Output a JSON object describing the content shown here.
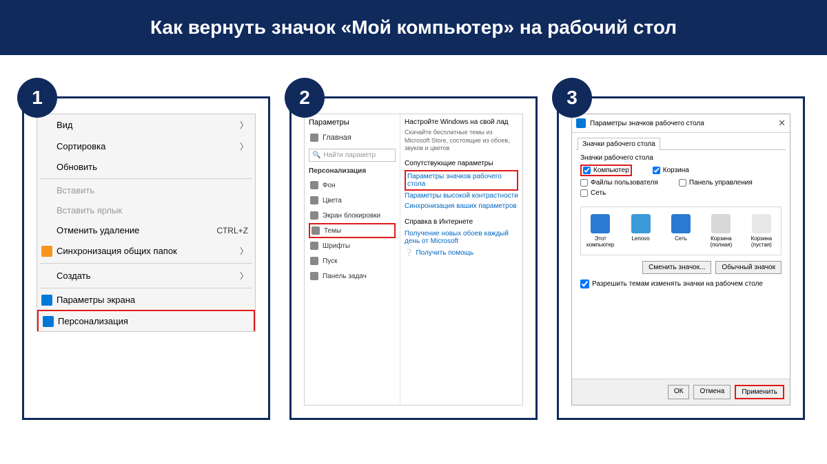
{
  "title": "Как вернуть значок «Мой компьютер» на рабочий стол",
  "steps": {
    "n1": "1",
    "n2": "2",
    "n3": "3"
  },
  "ctx": {
    "view": "Вид",
    "sort": "Сортировка",
    "refresh": "Обновить",
    "paste": "Вставить",
    "paste_shortcut": "Вставить ярлык",
    "undo_delete": "Отменить удаление",
    "undo_key": "CTRL+Z",
    "sync": "Синхронизация общих папок",
    "create": "Создать",
    "display": "Параметры экрана",
    "personalize": "Персонализация"
  },
  "settings": {
    "win": "Параметры",
    "home": "Главная",
    "search": "Найти параметр",
    "section": "Персонализация",
    "nav": {
      "background": "Фон",
      "colors": "Цвета",
      "lockscreen": "Экран блокировки",
      "themes": "Темы",
      "fonts": "Шрифты",
      "start": "Пуск",
      "taskbar": "Панель задач"
    },
    "right": {
      "h1": "Настройте Windows на свой лад",
      "p1": "Скачайте бесплатные темы из Microsoft Store, состоящие из обоев, звуков и цветов",
      "h2": "Сопутствующие параметры",
      "link1": "Параметры значков рабочего стола",
      "link2": "Параметры высокой контрастности",
      "link3": "Синхронизация ваших параметров",
      "h3": "Справка в Интернете",
      "link4": "Получение новых обоев каждый день от Microsoft",
      "help": "Получить помощь"
    }
  },
  "dlg": {
    "title": "Параметры значков рабочего стола",
    "tab": "Значки рабочего стола",
    "group": "Значки рабочего стола",
    "chk": {
      "computer": "Компьютер",
      "recycle": "Корзина",
      "userfiles": "Файлы пользователя",
      "control": "Панель управления",
      "network": "Сеть"
    },
    "icons": {
      "thispc": "Этот компьютер",
      "lenovo": "Lenovo",
      "network": "Сеть",
      "recycle_full": "Корзина (полная)",
      "recycle_empty": "Корзина (пустая)"
    },
    "btn_change": "Сменить значок...",
    "btn_default": "Обычный значок",
    "allow": "Разрешить темам изменять значки на рабочем столе",
    "ok": "ОК",
    "cancel": "Отмена",
    "apply": "Применить"
  }
}
